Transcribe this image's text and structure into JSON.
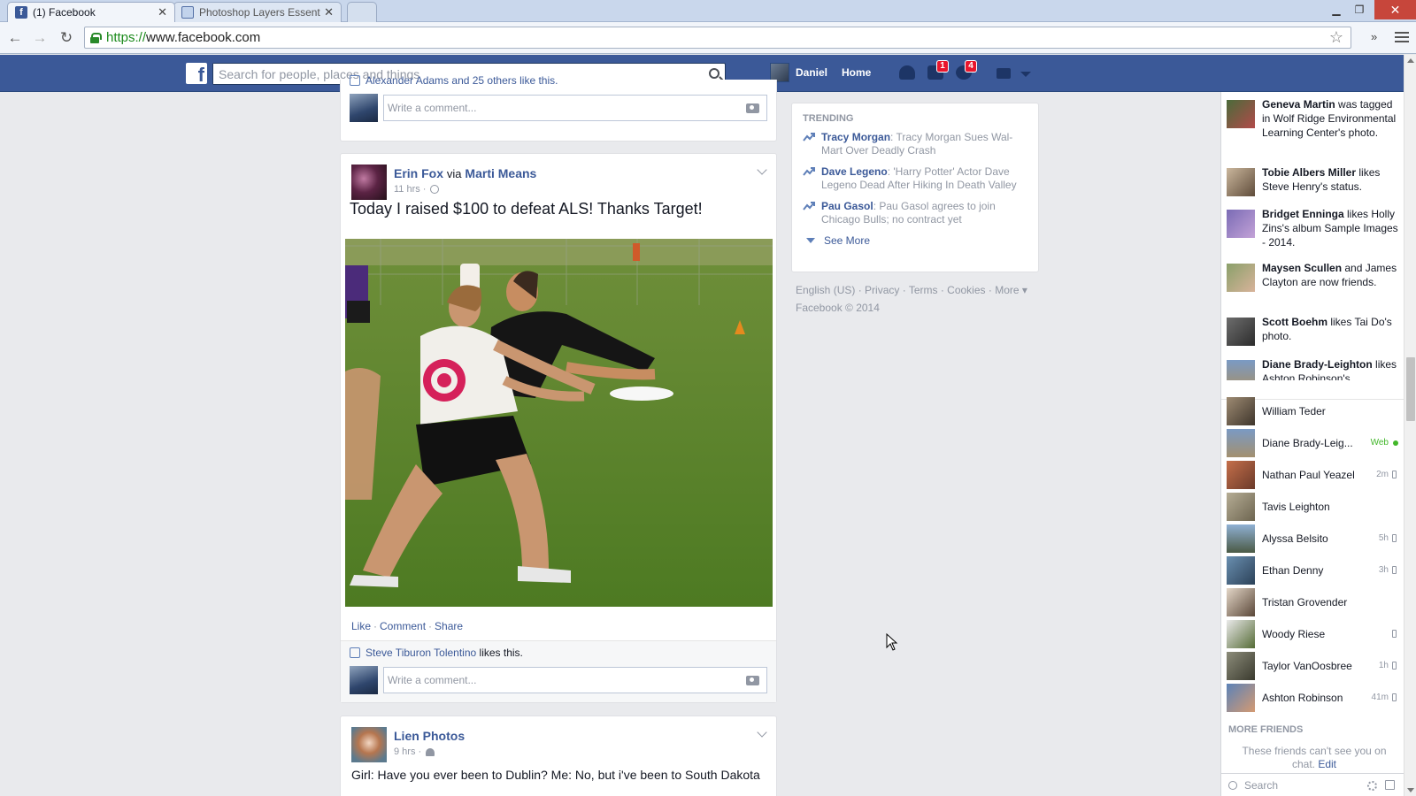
{
  "browser": {
    "tabs": [
      {
        "title": "(1) Facebook",
        "favicon": "facebook-favicon"
      },
      {
        "title": "Photoshop Layers Essenti",
        "favicon": "photoshop-favicon"
      }
    ],
    "url_scheme": "https://",
    "url_host": "www.facebook.com"
  },
  "bluebar": {
    "search_placeholder": "Search for people, places and things",
    "profile_name": "Daniel",
    "home_label": "Home",
    "messages_badge": "1",
    "notifications_badge": "4",
    "colors": {
      "bar": "#3b5998",
      "badge": "#e9162d"
    }
  },
  "feed": {
    "prev_story": {
      "likes_partial": "Alexander Adams and 25 others like this.",
      "comment_placeholder": "Write a comment..."
    },
    "erin_story": {
      "author": "Erin Fox",
      "via": "via",
      "via_name": "Marti Means",
      "time": "11 hrs",
      "text": "Today I raised $100 to defeat ALS! Thanks Target!",
      "actions": {
        "like": "Like",
        "comment": "Comment",
        "share": "Share"
      },
      "liker": "Steve Tiburon Tolentino",
      "likes_suffix": "likes this.",
      "comment_placeholder": "Write a comment..."
    },
    "lien_story": {
      "author": "Lien Photos",
      "time": "9 hrs",
      "text": "Girl: Have you ever been to Dublin? Me: No, but i've been to South Dakota"
    }
  },
  "trending": {
    "title": "TRENDING",
    "items": [
      {
        "name": "Tracy Morgan",
        "desc": ": Tracy Morgan Sues Wal-Mart Over Deadly Crash"
      },
      {
        "name": "Dave Legeno",
        "desc": ": 'Harry Potter' Actor Dave Legeno Dead After Hiking In Death Valley"
      },
      {
        "name": "Pau Gasol",
        "desc": ": Pau Gasol agrees to join Chicago Bulls; no contract yet"
      }
    ],
    "see_more": "See More"
  },
  "footer": {
    "english": "English (US)",
    "privacy": "Privacy",
    "terms": "Terms",
    "cookies": "Cookies",
    "more": "More ▾",
    "copyright": "Facebook © 2014"
  },
  "ticker": [
    {
      "actor": "Geneva Martin",
      "text": " was tagged in Wolf Ridge Environmental Learning Center's photo."
    },
    {
      "actor": "Tobie Albers Miller",
      "text": " likes Steve Henry's status."
    },
    {
      "actor": "Bridget Enninga",
      "text": " likes Holly Zins's album Sample Images - 2014."
    },
    {
      "actor": "Maysen Scullen",
      "text": " and James Clayton are now friends."
    },
    {
      "actor": "Scott Boehm",
      "text": " likes Tai Do's photo."
    },
    {
      "actor": "Diane Brady-Leighton",
      "text": " likes Ashton Robinson's"
    }
  ],
  "chat": {
    "friends": [
      {
        "name": "William Teder",
        "status": ""
      },
      {
        "name": "Diane Brady-Leig...",
        "status": "Web"
      },
      {
        "name": "Nathan Paul Yeazel",
        "status": "2m"
      },
      {
        "name": "Tavis Leighton",
        "status": ""
      },
      {
        "name": "Alyssa Belsito",
        "status": "5h"
      },
      {
        "name": "Ethan Denny",
        "status": "3h"
      },
      {
        "name": "Tristan Grovender",
        "status": ""
      },
      {
        "name": "Woody Riese",
        "status": ""
      },
      {
        "name": "Taylor VanOosbree",
        "status": "1h"
      },
      {
        "name": "Ashton Robinson",
        "status": "41m"
      }
    ],
    "more_friends": "MORE FRIENDS",
    "notice": "These friends can't see you on chat.",
    "edit_link": "Edit",
    "search_placeholder": "Search"
  }
}
